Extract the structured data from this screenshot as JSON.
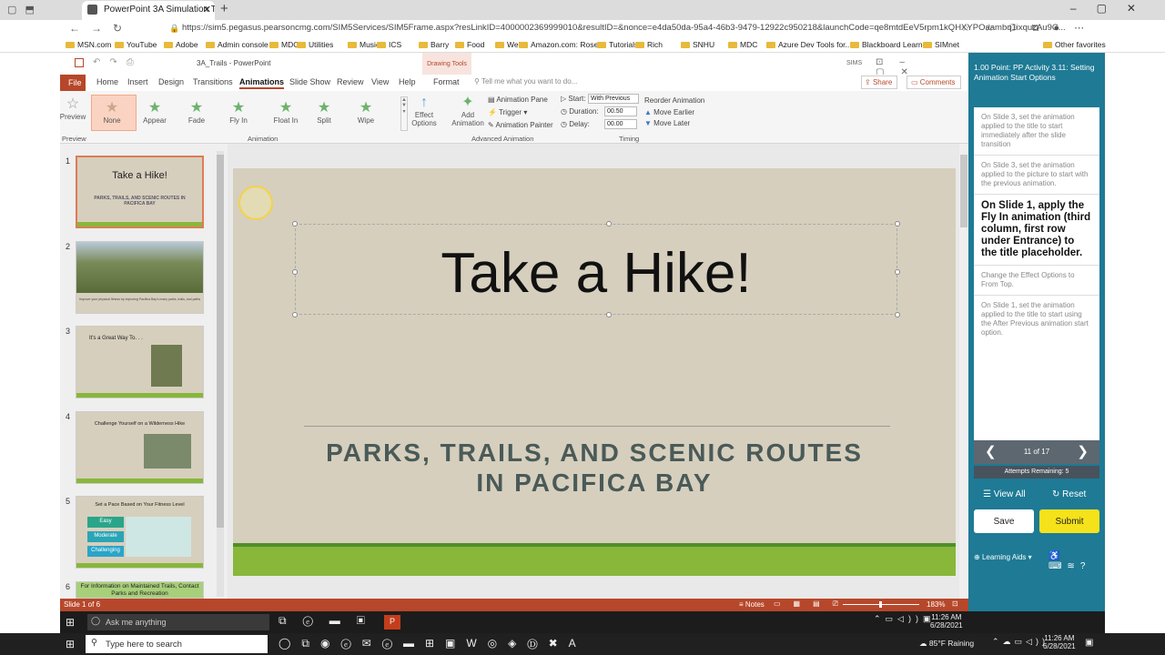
{
  "browser": {
    "tab_title": "PowerPoint 3A Simulation Traini",
    "url": "https://sim5.pegasus.pearsoncmg.com/SIM5Services/SIM5Frame.aspx?resLinkID=4000002369999010&resultID=&nonce=e4da50da-95a4-46b3-9479-12922c950218&launchCode=qe8mtdEeV5rpm1kQHXYPOaambq1ixquzAu9C...",
    "bookmarks": [
      "MSN.com",
      "YouTube",
      "Adobe",
      "Admin console",
      "MDC",
      "Utilities",
      "Music",
      "ICS",
      "Barry",
      "Food",
      "Web",
      "Amazon.com: Rose...",
      "Tutorials",
      "Rich",
      "SNHU",
      "MDC",
      "Azure Dev Tools for...",
      "Blackboard Learn",
      "SIMnet"
    ],
    "other_favorites": "Other favorites"
  },
  "ppt": {
    "file_title": "3A_Trails - PowerPoint",
    "drawing_tools": "Drawing Tools",
    "sims": "SIMS",
    "tabs": [
      "File",
      "Home",
      "Insert",
      "Design",
      "Transitions",
      "Animations",
      "Slide Show",
      "Review",
      "View",
      "Help",
      "Format"
    ],
    "active_tab": "Animations",
    "tell_me": "Tell me what you want to do...",
    "share": "Share",
    "comments": "Comments",
    "preview_label": "Preview",
    "animations": [
      "None",
      "Appear",
      "Fade",
      "Fly In",
      "Float In",
      "Split",
      "Wipe"
    ],
    "effect_options": "Effect Options",
    "add_animation": "Add Animation",
    "animation_pane": "Animation Pane",
    "trigger": "Trigger",
    "animation_painter": "Animation Painter",
    "start_label": "Start:",
    "start_value": "With Previous",
    "duration_label": "Duration:",
    "duration_value": "00.50",
    "delay_label": "Delay:",
    "delay_value": "00.00",
    "reorder": "Reorder Animation",
    "move_earlier": "Move Earlier",
    "move_later": "Move Later",
    "groups": [
      "Preview",
      "Animation",
      "Advanced Animation",
      "Timing"
    ],
    "thumbnails": [
      {
        "num": "1",
        "title": "Take a Hike!",
        "sub": "PARKS, TRAILS, AND SCENIC ROUTES IN PACIFICA BAY"
      },
      {
        "num": "2",
        "title": "",
        "sub": "Improve your physical fitness by exploring Pacifica Bay's many parks, trails, and paths"
      },
      {
        "num": "3",
        "title": "It's a Great Way To. . .",
        "sub": ""
      },
      {
        "num": "4",
        "title": "Challenge Yourself on a Wilderness Hike",
        "sub": ""
      },
      {
        "num": "5",
        "title": "Set a Pace Based on Your Fitness Level",
        "sub": ""
      },
      {
        "num": "6",
        "title": "For Information on Maintained Trails, Contact Parks and Recreation",
        "sub": ""
      }
    ],
    "pace_levels": [
      "Easy",
      "Moderate",
      "Challenging"
    ],
    "slide_title": "Take a Hike!",
    "slide_subtitle_1": "PARKS, TRAILS, AND SCENIC ROUTES",
    "slide_subtitle_2": "IN PACIFICA BAY",
    "status_slide": "Slide 1 of 6",
    "notes": "Notes",
    "zoom": "183%"
  },
  "sim": {
    "header": "1.00 Point: PP Activity 3.11: Setting Animation Start Options",
    "tasks": [
      "On Slide 3, set the animation applied to the title to start immediately after the slide transition",
      "On Slide 3, set the animation applied to the picture to start with the previous animation.",
      "On Slide 1, apply the Fly In animation (third column, first row under Entrance) to the title placeholder.",
      "Change the Effect Options to From Top.",
      "On Slide 1, set the animation applied to the title to start using the After Previous animation start option."
    ],
    "active_task_index": 2,
    "progress": "11 of 17",
    "attempts": "Attempts Remaining: 5",
    "view_all": "View All",
    "reset": "Reset",
    "save": "Save",
    "submit": "Submit",
    "learning_aids": "Learning Aids"
  },
  "taskbar_inner": {
    "search": "Ask me anything",
    "time": "11:26 AM",
    "date": "6/28/2021"
  },
  "taskbar_outer": {
    "search": "Type here to search",
    "weather": "85°F  Raining",
    "time": "11:26 AM",
    "date": "6/28/2021"
  }
}
